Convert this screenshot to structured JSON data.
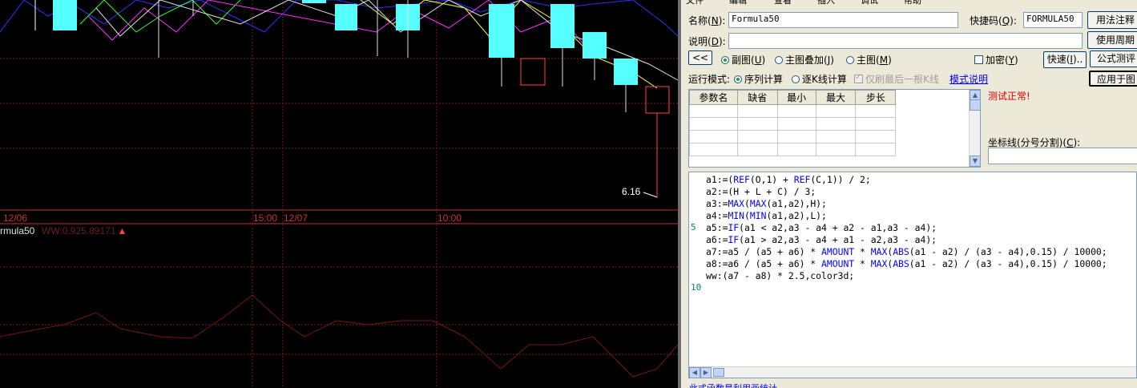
{
  "chart": {
    "indicator_name": "rmula50",
    "indicator_value": "WW:0.925.89171",
    "price_label": "6.16",
    "time_labels": [
      "12/06",
      "15:00",
      "12/07",
      "10:00"
    ]
  },
  "editor": {
    "menu": [
      "文件",
      "编辑",
      "查看",
      "插入",
      "调试",
      "帮助"
    ],
    "name_label": "名称",
    "name_key": "N",
    "name_value": "Formula50",
    "shortcut_label": "快捷码",
    "shortcut_key": "Q",
    "shortcut_value": "FORMULA50",
    "usage_button": "用法注释",
    "desc_label": "说明",
    "desc_key": "D",
    "desc_value": "",
    "period_button": "使用周期",
    "back_button": "<<",
    "radio_sub": "副图",
    "radio_sub_key": "U",
    "radio_overlay": "主图叠加",
    "radio_overlay_key": "J",
    "radio_main": "主图",
    "radio_main_key": "M",
    "encrypt_label": "加密",
    "encrypt_key": "Y",
    "quick_button": "快速",
    "quick_key": "I",
    "test_button": "公式测评",
    "mode_label": "运行模式:",
    "mode_seq": "序列计算",
    "mode_bar": "逐K线计算",
    "last_bar_only": "仅刷最后一根K线",
    "mode_help": "模式说明",
    "apply_button": "应用于图",
    "test_status": "测试正常!",
    "coord_label": "坐标线(分号分割)",
    "coord_key": "C",
    "coord_value": "",
    "param_headers": [
      "参数名",
      "缺省",
      "最小",
      "最大",
      "步长"
    ],
    "line_numbers": [
      "5",
      "10"
    ],
    "code_lines": [
      "a1:=(REF(O,1) + REF(C,1)) / 2;",
      "a2:=(H + L + C) / 3;",
      "a3:=MAX(MAX(a1,a2),H);",
      "a4:=MIN(MIN(a1,a2),L);",
      "a5:=IF(a1 < a2,a3 - a4 + a2 - a1,a3 - a4);",
      "a6:=IF(a1 > a2,a3 - a4 + a1 - a2,a3 - a4);",
      "a7:=a5 / (a5 + a6) * AMOUNT * MAX(ABS(a1 - a2) / (a3 - a4),0.15) / 10000;",
      "a8:=a6 / (a5 + a6) * AMOUNT * MAX(ABS(a1 - a2) / (a3 - a4),0.15) / 10000;",
      "ww:(a7 - a8) * 2.5,color3d;",
      ""
    ],
    "bottom_hint": "此式函数是利用画统计..."
  },
  "colors": {
    "candle_up": "#ff4545",
    "candle_down": "#55ffff",
    "grid": "#7a1c1c",
    "indicator_line": "#7a1414"
  }
}
